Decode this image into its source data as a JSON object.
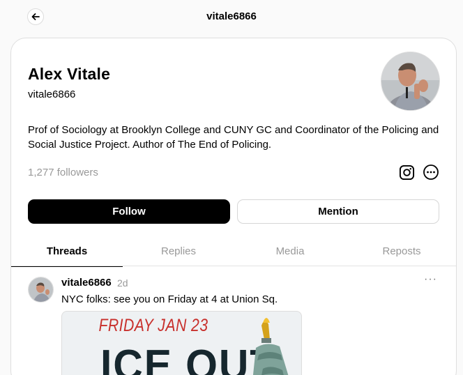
{
  "header": {
    "title": "vitale6866"
  },
  "profile": {
    "name": "Alex Vitale",
    "handle": "vitale6866",
    "bio": "Prof of Sociology at Brooklyn College and CUNY GC and Coordinator of the Policing and Social Justice Project. Author of The End of Policing.",
    "followers": "1,277 followers"
  },
  "actions": {
    "follow_label": "Follow",
    "mention_label": "Mention"
  },
  "tabs": [
    {
      "label": "Threads",
      "active": true
    },
    {
      "label": "Replies",
      "active": false
    },
    {
      "label": "Media",
      "active": false
    },
    {
      "label": "Reposts",
      "active": false
    }
  ],
  "post": {
    "username": "vitale6866",
    "time": "2d",
    "more": "···",
    "text": "NYC folks: see you on Friday at 4 at Union Sq.",
    "image": {
      "line1": "FRIDAY JAN 23",
      "line2": "ICE OUT"
    }
  },
  "icons": [
    "back-arrow-icon",
    "instagram-icon",
    "more-options-icon"
  ]
}
